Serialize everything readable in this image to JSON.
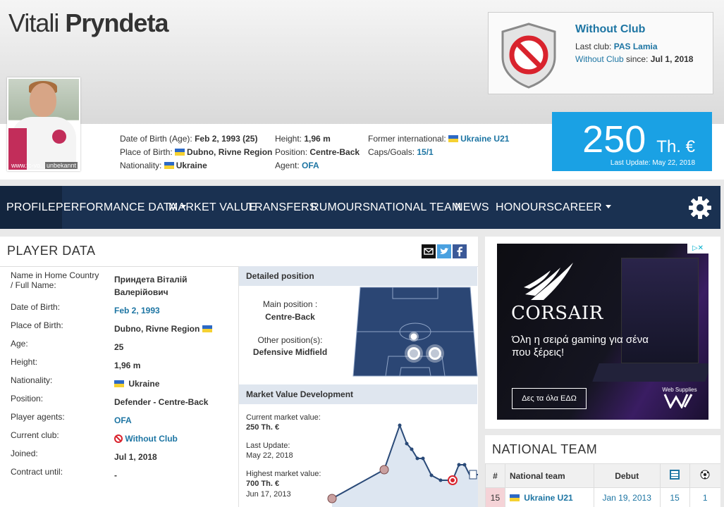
{
  "player": {
    "first_name": "Vitali",
    "last_name": "Pryndeta",
    "photo_caption": "unbekannt",
    "photo_url": "www.fc-vo..."
  },
  "info": {
    "dob_label": "Date of Birth (Age):",
    "dob_value": "Feb 2, 1993 (25)",
    "pob_label": "Place of Birth:",
    "pob_value": "Dubno, Rivne Region",
    "nationality_label": "Nationality:",
    "nationality_value": "Ukraine",
    "height_label": "Height:",
    "height_value": "1,96 m",
    "position_label": "Position:",
    "position_value": "Centre-Back",
    "agent_label": "Agent:",
    "agent_value": "OFA",
    "former_label": "Former international:",
    "former_value": "Ukraine U21",
    "caps_label": "Caps/Goals:",
    "caps_value": "15/1"
  },
  "club": {
    "name": "Without Club",
    "last_club_label": "Last club:",
    "last_club_value": "PAS Lamia",
    "since_link": "Without Club",
    "since_label": "since:",
    "since_value": "Jul 1, 2018"
  },
  "market_value": {
    "amount": "250",
    "unit": "Th. €",
    "last_update": "Last Update: May 22, 2018"
  },
  "nav": {
    "profile": "PROFILE",
    "performance": "PERFORMANCE DATA",
    "market_value": "MARKET VALUE",
    "transfers": "TRANSFERS",
    "rumours": "RUMOURS",
    "national_team": "NATIONAL TEAM",
    "news": "NEWS",
    "honours": "HONOURS",
    "career": "CAREER"
  },
  "player_data": {
    "title": "PLAYER DATA",
    "rows": [
      {
        "label": "Name in Home Country / Full Name:",
        "value": "Приндета Віталій Валерійович"
      },
      {
        "label": "Date of Birth:",
        "value": "Feb 2, 1993"
      },
      {
        "label": "Place of Birth:",
        "value": "Dubno, Rivne Region"
      },
      {
        "label": "Age:",
        "value": "25"
      },
      {
        "label": "Height:",
        "value": "1,96 m"
      },
      {
        "label": "Nationality:",
        "value": "Ukraine"
      },
      {
        "label": "Position:",
        "value": "Defender - Centre-Back"
      },
      {
        "label": "Player agents:",
        "value": "OFA"
      },
      {
        "label": "Current club:",
        "value": "Without Club"
      },
      {
        "label": "Joined:",
        "value": "Jul 1, 2018"
      },
      {
        "label": "Contract until:",
        "value": "-"
      }
    ]
  },
  "detailed_position": {
    "title": "Detailed position",
    "main_label": "Main position :",
    "main_value": "Centre-Back",
    "other_label": "Other position(s):",
    "other_value": "Defensive Midfield"
  },
  "mv_development": {
    "title": "Market Value Development",
    "current_label": "Current market value:",
    "current_value": "250 Th. €",
    "update_label": "Last Update:",
    "update_value": "May 22, 2018",
    "highest_label": "Highest market value:",
    "highest_value": "700 Th. €",
    "highest_date": "Jun 17, 2013"
  },
  "ad": {
    "brand": "CORSAIR",
    "text": "Όλη η σειρά gaming για σένα που ξέρεις!",
    "button": "Δες τα όλα ΕΔΩ",
    "supplier": "Web Supplies",
    "close": "▷✕"
  },
  "national_team": {
    "title": "NATIONAL TEAM",
    "headers": {
      "num": "#",
      "team": "National team",
      "debut": "Debut"
    },
    "row": {
      "num": "15",
      "team": "Ukraine U21",
      "debut": "Jan 19, 2013",
      "caps": "15",
      "goals": "1"
    }
  },
  "colors": {
    "nav_bg": "#1a3151",
    "market_value_bg": "#1aa1e4",
    "link": "#1d75a3"
  }
}
